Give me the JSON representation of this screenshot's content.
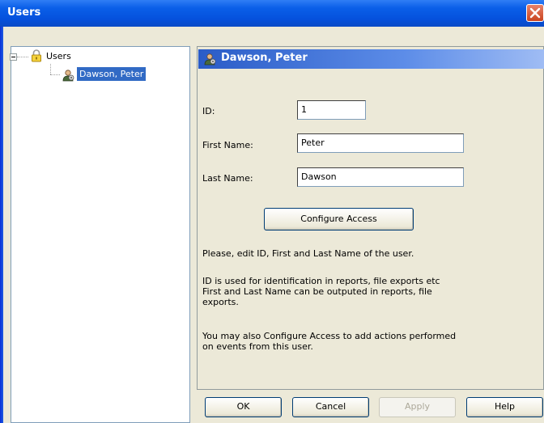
{
  "window": {
    "title": "Users"
  },
  "tree": {
    "root_label": "Users",
    "children": [
      {
        "label": "Dawson, Peter",
        "selected": true
      }
    ]
  },
  "panel": {
    "header": "Dawson, Peter",
    "id_label": "ID:",
    "id_value": "1",
    "first_name_label": "First Name:",
    "first_name_value": "Peter",
    "last_name_label": "Last Name:",
    "last_name_value": "Dawson",
    "configure_label": "Configure Access",
    "help_1": "Please, edit ID, First and Last Name of the user.",
    "help_2a": "ID is used for identification in reports, file exports etc",
    "help_2b": "First and Last Name can be outputed in reports, file",
    "help_2c": "exports.",
    "help_3a": "You may also Configure Access to add actions performed",
    "help_3b": "on events from this user."
  },
  "buttons": {
    "ok": "OK",
    "cancel": "Cancel",
    "apply": "Apply",
    "help": "Help"
  },
  "colors": {
    "title_bar": "#0551dd",
    "selection": "#316ac5",
    "window_bg": "#ece9d8",
    "close": "#c9431e"
  }
}
